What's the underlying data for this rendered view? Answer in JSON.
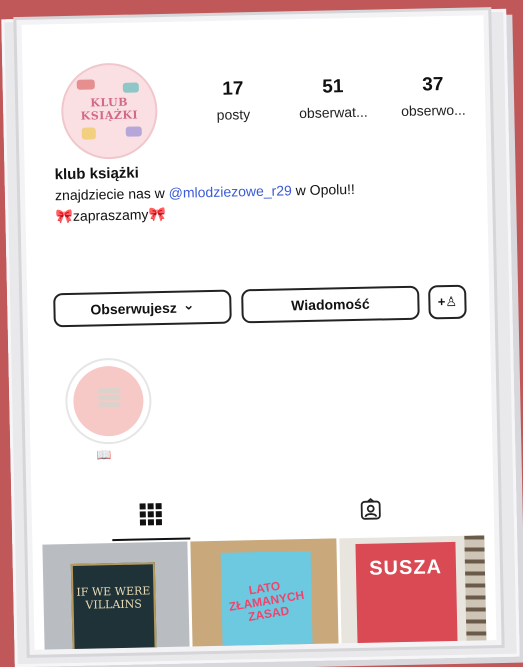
{
  "profile": {
    "avatar_text": "KLUB\nKSIĄŻKI",
    "name": "klub książki",
    "bio_prefix": "znajdziecie nas w ",
    "bio_handle": "@mlodziezowe_r29",
    "bio_suffix": " w Opolu!!",
    "bio_line2": "zapraszamy",
    "bow_emoji": "🎀"
  },
  "stats": [
    {
      "num": "17",
      "label": "posty"
    },
    {
      "num": "51",
      "label": "obserwat..."
    },
    {
      "num": "37",
      "label": "obserwo..."
    }
  ],
  "buttons": {
    "follow_label": "Obserwujesz",
    "follow_chevron": "⌄",
    "message_label": "Wiadomość",
    "add_person": "+♙"
  },
  "highlights": [
    {
      "label": "📖"
    }
  ],
  "posts": [
    {
      "title": "IF WE WERE VILLAINS"
    },
    {
      "title": "LATO ZŁAMANYCH ZASAD"
    },
    {
      "title": "SUSZA"
    }
  ],
  "colors": {
    "background": "#c0585a",
    "link": "#3b5bd6",
    "highlight_bg": "#f6c9c6"
  }
}
